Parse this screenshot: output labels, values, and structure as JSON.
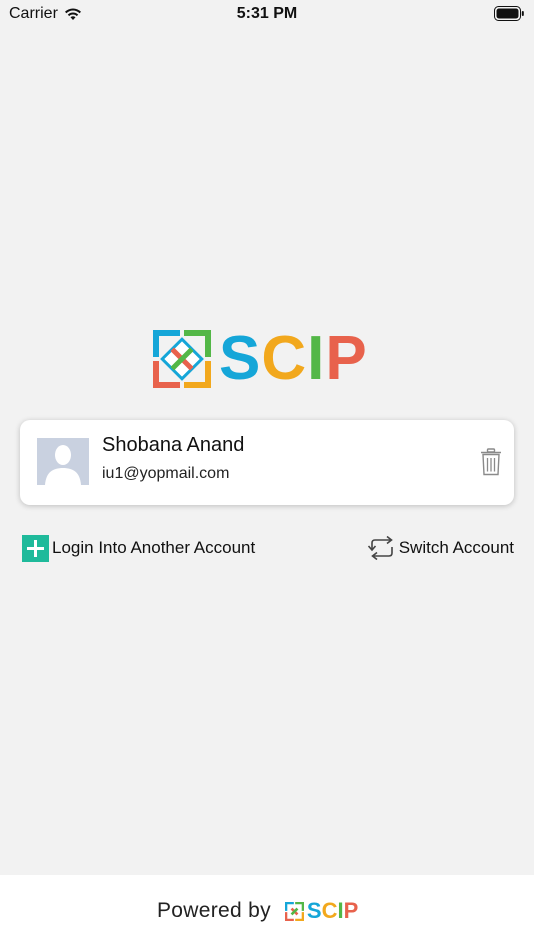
{
  "status_bar": {
    "carrier": "Carrier",
    "time": "5:31 PM",
    "icons": [
      "wifi-icon",
      "battery-icon"
    ]
  },
  "logo": {
    "letters": [
      "S",
      "C",
      "I",
      "P"
    ],
    "colors": {
      "s": "#15a6d8",
      "c": "#f2a81d",
      "i": "#53b747",
      "p": "#e8624c"
    }
  },
  "account": {
    "name": "Shobana Anand",
    "email": "iu1@yopmail.com",
    "icons": [
      "avatar-placeholder-icon",
      "trash-icon"
    ]
  },
  "actions": {
    "login_another": "Login Into Another Account",
    "switch_account": "Switch Account",
    "icons": [
      "plus-icon",
      "switch-arrows-icon"
    ],
    "plus_color": "#1fba9b"
  },
  "footer": {
    "powered_by": "Powered by",
    "brand_letters": [
      "S",
      "C",
      "I",
      "P"
    ]
  }
}
